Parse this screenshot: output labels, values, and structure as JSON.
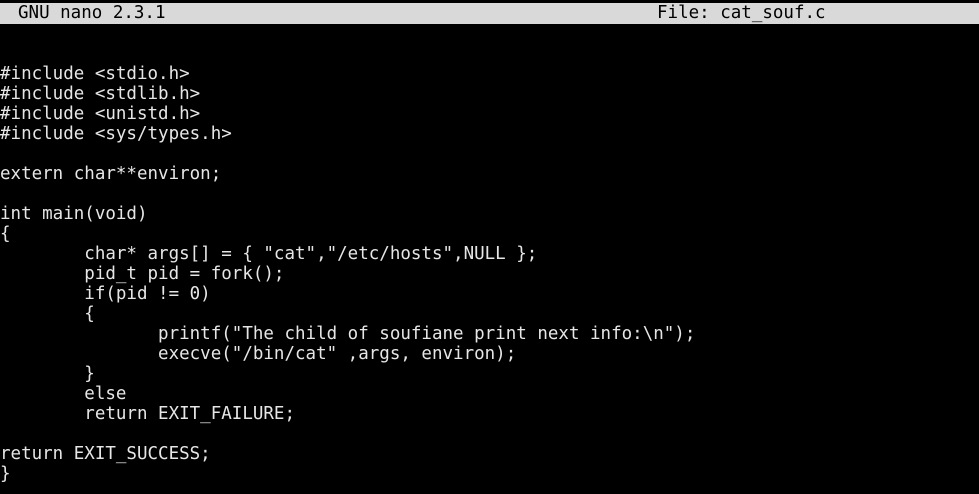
{
  "titlebar": {
    "app": "GNU nano 2.3.1",
    "file": "File: cat_souf.c"
  },
  "editor": {
    "lines": [
      "",
      "#include <stdio.h>",
      "#include <stdlib.h>",
      "#include <unistd.h>",
      "#include <sys/types.h>",
      "",
      "extern char**environ;",
      "",
      "int main(void)",
      "{",
      "        char* args[] = { \"cat\",\"/etc/hosts\",NULL };",
      "        pid_t pid = fork();",
      "        if(pid != 0)",
      "        {",
      "               printf(\"The child of soufiane print next info:\\n\");",
      "               execve(\"/bin/cat\" ,args, environ);",
      "        }",
      "        else",
      "        return EXIT_FAILURE;",
      "",
      "return EXIT_SUCCESS;",
      "}"
    ]
  }
}
